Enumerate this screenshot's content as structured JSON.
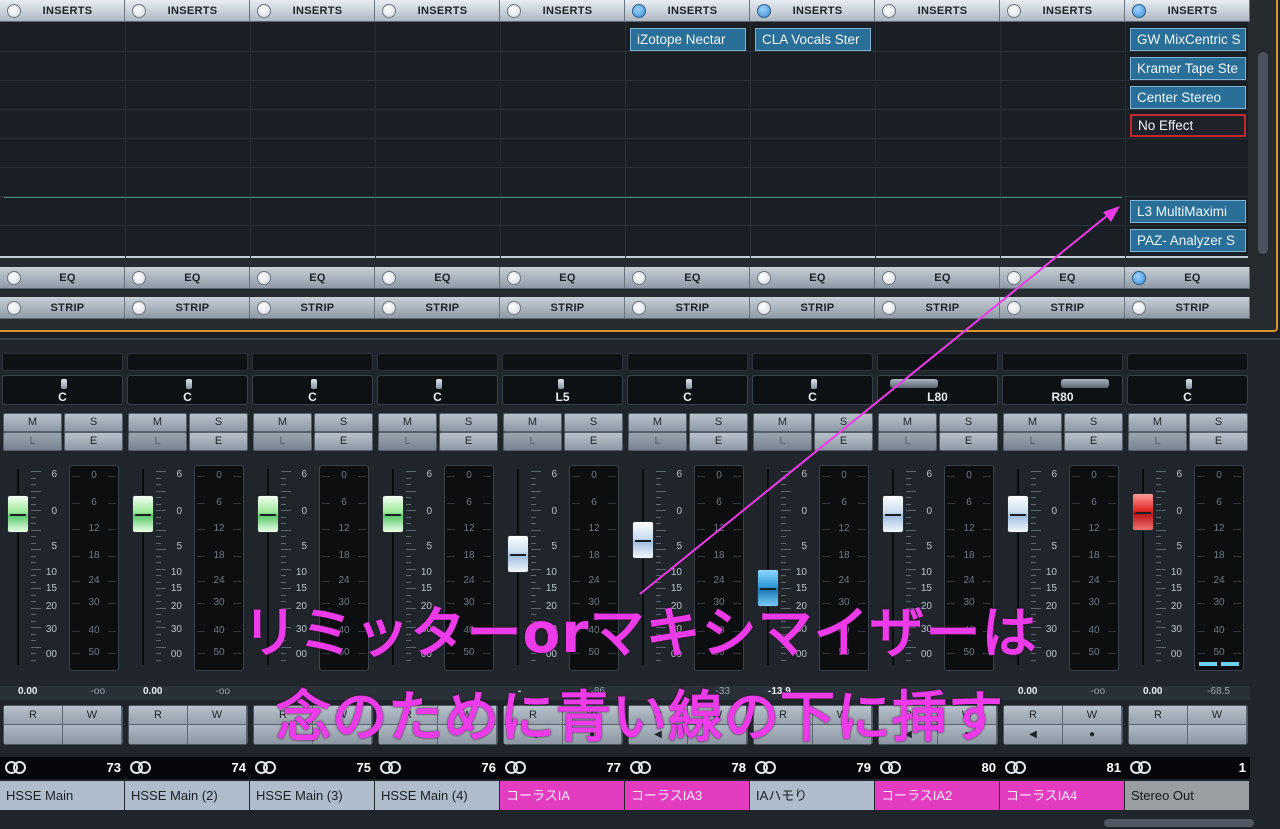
{
  "rack": {
    "inserts_label": "INSERTS",
    "eq_label": "EQ",
    "strip_label": "STRIP",
    "insert_led_on": [
      false,
      false,
      false,
      false,
      false,
      true,
      true,
      false,
      false,
      true
    ],
    "eq_led_on": [
      false,
      false,
      false,
      false,
      false,
      false,
      false,
      false,
      false,
      true
    ],
    "plugins": {
      "ch5": [
        "iZotope Nectar"
      ],
      "ch6": [
        "CLA Vocals Ster"
      ],
      "ch9_top": [
        "GW MixCentric S",
        "Kramer Tape Ste",
        "Center Stereo"
      ],
      "ch9_empty": "No Effect",
      "ch9_bottom": [
        "L3 MultiMaximi",
        "PAZ- Analyzer S"
      ]
    }
  },
  "mixer": {
    "buttons": {
      "mute": "M",
      "solo": "S",
      "listen": "L",
      "edit": "E",
      "read": "R",
      "write": "W"
    },
    "fader_scale": [
      "6",
      "0",
      "5",
      "10",
      "15",
      "20",
      "30",
      "00"
    ],
    "meter_scale": [
      "0",
      "6",
      "12",
      "18",
      "24",
      "30",
      "40",
      "50"
    ],
    "channels": [
      {
        "pan": "C",
        "fader_color": "green",
        "vol_left": "0.00",
        "vol_right": "-oo",
        "number": "73",
        "name": "HSSE Main",
        "color": "default"
      },
      {
        "pan": "C",
        "fader_color": "green",
        "vol_left": "0.00",
        "vol_right": "-oo",
        "number": "74",
        "name": "HSSE Main (2)",
        "color": "default"
      },
      {
        "pan": "C",
        "fader_color": "green",
        "vol_left": "",
        "vol_right": "",
        "number": "75",
        "name": "HSSE Main (3)",
        "color": "default"
      },
      {
        "pan": "C",
        "fader_color": "green",
        "vol_left": "",
        "vol_right": "",
        "number": "76",
        "name": "HSSE Main (4)",
        "color": "default"
      },
      {
        "pan": "L5",
        "fader_color": "white",
        "vol_left": "-",
        "vol_right": "-86",
        "number": "77",
        "name": "コーラスIA",
        "color": "pink"
      },
      {
        "pan": "C",
        "fader_color": "white",
        "vol_left": "",
        "vol_right": "-33",
        "number": "78",
        "name": "コーラスIA3",
        "color": "pink"
      },
      {
        "pan": "C",
        "fader_color": "cyan",
        "vol_left": "-13.9",
        "vol_right": "",
        "number": "79",
        "name": "IAハモり",
        "color": "default"
      },
      {
        "pan": "L80",
        "fader_color": "white",
        "vol_left": "",
        "vol_right": "",
        "number": "80",
        "name": "コーラスIA2",
        "color": "pink"
      },
      {
        "pan": "R80",
        "fader_color": "white",
        "vol_left": "0.00",
        "vol_right": "-oo",
        "number": "81",
        "name": "コーラスIA4",
        "color": "pink"
      },
      {
        "pan": "C",
        "fader_color": "red",
        "vol_left": "0.00",
        "vol_right": "-68.5",
        "number": "1",
        "name": "Stereo Out",
        "color": "grey"
      }
    ]
  },
  "annotation": {
    "line1": "リミッターorマキシマイザーは",
    "line2": "念のために青い線の下に挿す",
    "color": "#ee3bea"
  }
}
